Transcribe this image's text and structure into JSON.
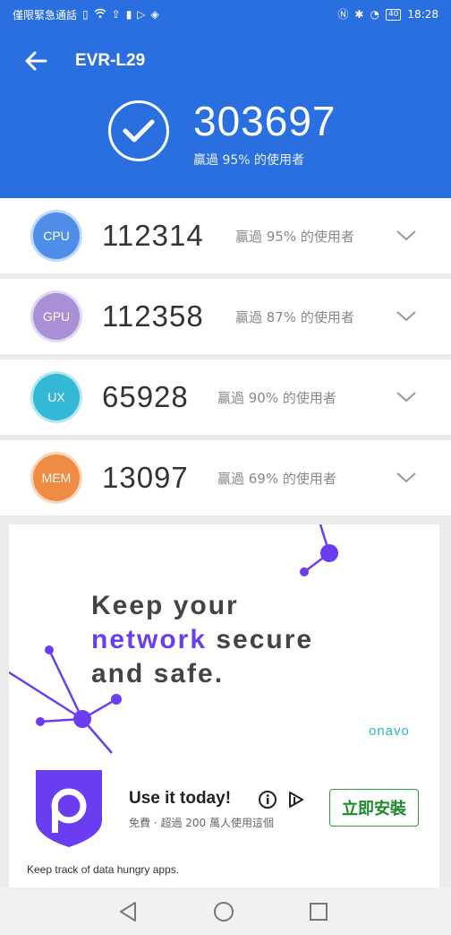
{
  "status_bar": {
    "carrier": "僅限緊急通話",
    "time": "18:28",
    "battery": "40",
    "icons": [
      "sim-icon",
      "wifi-icon",
      "upload-icon",
      "battery-saver-icon",
      "play-store-icon",
      "shield-app-icon",
      "nfc-icon",
      "bluetooth-icon",
      "speed-icon",
      "battery-icon"
    ]
  },
  "header": {
    "device_name": "EVR-L29",
    "total_score": "303697",
    "total_subtitle": "贏過 95% 的使用者",
    "colors": {
      "background": "#2a6fe0"
    }
  },
  "scores": [
    {
      "label": "CPU",
      "value": "112314",
      "percent_text": "贏過 95% 的使用者",
      "color": "#4f8ee8"
    },
    {
      "label": "GPU",
      "value": "112358",
      "percent_text": "贏過 87% 的使用者",
      "color": "#a98fd6"
    },
    {
      "label": "UX",
      "value": "65928",
      "percent_text": "贏過 90% 的使用者",
      "color": "#35b8d6"
    },
    {
      "label": "MEM",
      "value": "13097",
      "percent_text": "贏過 69% 的使用者",
      "color": "#ef8c43"
    }
  ],
  "ad": {
    "headline_1": "Keep your",
    "headline_2a": "network",
    "headline_2b": " secure",
    "headline_3": "and safe.",
    "brand": "onavo",
    "app_name": "Use it today!",
    "app_subtitle": "免費 · 超過 200 萬人使用這個",
    "install_label": "立即安裝",
    "footer": "Keep track of data hungry apps."
  },
  "nav": {
    "back": "back-icon",
    "home": "home-icon",
    "recents": "recents-icon"
  }
}
